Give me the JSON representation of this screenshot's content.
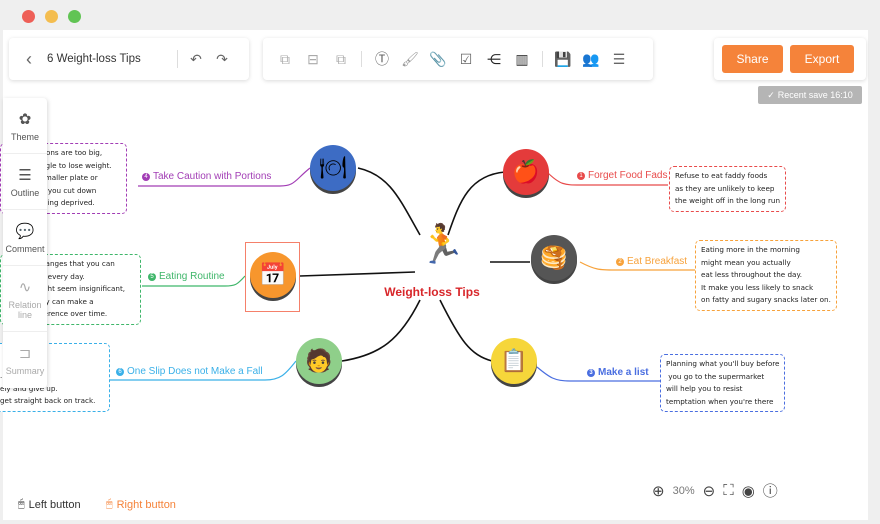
{
  "window": {
    "dots": [
      "#ee5f57",
      "#f4bd4f",
      "#61c454"
    ]
  },
  "header": {
    "title": "6 Weight-loss Tips",
    "share": "Share",
    "export": "Export",
    "save_status": "Recent save 16:10"
  },
  "sidebar": {
    "items": [
      {
        "label": "Theme",
        "icon": "theme-icon"
      },
      {
        "label": "Outline",
        "icon": "list-icon"
      },
      {
        "label": "Comment",
        "icon": "comment-icon"
      },
      {
        "label": "Relation line",
        "icon": "relation-icon"
      },
      {
        "label": "Summary",
        "icon": "summary-icon"
      }
    ]
  },
  "map": {
    "central": "Weight-loss Tips",
    "topics": [
      {
        "num": "1",
        "label": "Forget Food Fads",
        "color": "#e84b4b",
        "note": "Refuse to eat faddy foods\nas they are unlikely to keep\nthe weight off in the long run"
      },
      {
        "num": "2",
        "label": "Eat Breakfast",
        "color": "#f7a23b",
        "note": "Eating more in the morning\nmight mean you actually\neat less throughout the day.\nIt make you less likely to snack\non fatty and sugary snacks later on."
      },
      {
        "num": "3",
        "label": "Make a list",
        "color": "#4a6ee0",
        "note": "Planning what you'll buy before\n you go to the supermarket\nwill help you to resist\ntemptation when you're there"
      },
      {
        "num": "4",
        "label": "Take Caution with Portions",
        "color": "#a23db5",
        "note": "rions are too big,\nggle to lose weight.\nsmaller plate or\np you cut down\neling deprived."
      },
      {
        "num": "5",
        "label": "Eating Routine",
        "color": "#3fb66a",
        "note": "hanges that you can\no every day.\night seem insignificant,\ney can make a\nference over time."
      },
      {
        "num": "6",
        "label": "One Slip Does not Make a Fall",
        "color": "#3ab0e8",
        "note": "...\nely and give up.\nget straight back on track."
      }
    ]
  },
  "footer": {
    "left_button": "Left button",
    "right_button": "Right button",
    "zoom": "30%"
  }
}
